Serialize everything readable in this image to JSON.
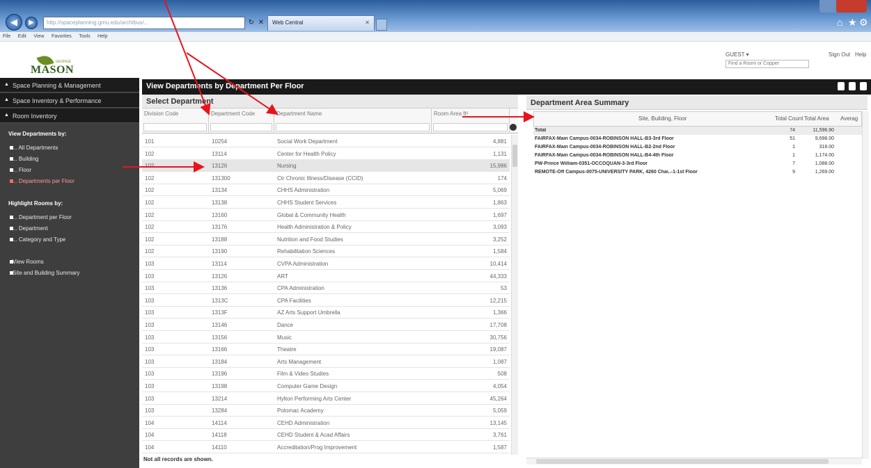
{
  "browser": {
    "address": "http://spaceplanning.gmu.edu/archibus/...",
    "tab_title": "Web Central",
    "menu": [
      "File",
      "Edit",
      "View",
      "Favorites",
      "Tools",
      "Help"
    ]
  },
  "header": {
    "logo_text": "MASON",
    "logo_small": "GEORGE",
    "user": "GUEST ▾",
    "sign_out": "Sign Out",
    "help": "Help",
    "find_placeholder": "Find a Room or Copper"
  },
  "sidebar": {
    "menus": [
      "Space Planning & Management",
      "Space Inventory & Performance",
      "Room Inventory"
    ],
    "view_heading": "View Departments by:",
    "view_links": [
      "... All Departments",
      "... Building",
      "... Floor",
      "... Departments per Floor"
    ],
    "highlight_heading": "Highlight Rooms by:",
    "highlight_links": [
      "... Department per Floor",
      "... Department",
      "... Category and Type"
    ],
    "other_links": [
      "View Rooms",
      "Site and Building Summary"
    ]
  },
  "main": {
    "title": "View Departments by Department Per Floor",
    "select_title": "Select Department",
    "columns": [
      "Division Code",
      "Department Code",
      "Department Name",
      "Room Area ft²"
    ],
    "rows": [
      [
        "101",
        "10254",
        "Social Work Department",
        "4,881"
      ],
      [
        "102",
        "13114",
        "Center for Health Policy",
        "1,131"
      ],
      [
        "102",
        "13126",
        "Nursing",
        "15,986"
      ],
      [
        "102",
        "131300",
        "Ctr Chronic Illness/Disease (CCID)",
        "174"
      ],
      [
        "102",
        "13134",
        "CHHS Administration",
        "5,069"
      ],
      [
        "102",
        "13138",
        "CHHS Student Services",
        "1,863"
      ],
      [
        "102",
        "13160",
        "Global & Community Health",
        "1,697"
      ],
      [
        "102",
        "13176",
        "Health Administration & Policy",
        "3,093"
      ],
      [
        "102",
        "13188",
        "Nutrition and Food Studies",
        "3,252"
      ],
      [
        "102",
        "13190",
        "Rehabilitation Sciences",
        "1,584"
      ],
      [
        "103",
        "13114",
        "CVPA Administration",
        "10,414"
      ],
      [
        "103",
        "13126",
        "ART",
        "44,333"
      ],
      [
        "103",
        "13136",
        "CPA Administration",
        "53"
      ],
      [
        "103",
        "1313C",
        "CPA Facilities",
        "12,215"
      ],
      [
        "103",
        "1313F",
        "AZ Arts Support Umbrella",
        "1,366"
      ],
      [
        "103",
        "13146",
        "Dance",
        "17,708"
      ],
      [
        "103",
        "13156",
        "Music",
        "30,756"
      ],
      [
        "103",
        "13166",
        "Theatre",
        "19,087"
      ],
      [
        "103",
        "13184",
        "Arts Management",
        "1,087"
      ],
      [
        "103",
        "13196",
        "Film & Video Studies",
        "508"
      ],
      [
        "103",
        "13198",
        "Computer Game Design",
        "4,054"
      ],
      [
        "103",
        "13214",
        "Hylton Performing Arts Center",
        "45,264"
      ],
      [
        "103",
        "13284",
        "Potomac Academy",
        "5,059"
      ],
      [
        "104",
        "14114",
        "CEHD Administration",
        "13,145"
      ],
      [
        "104",
        "14118",
        "CEHD Student & Acad Affairs",
        "3,761"
      ],
      [
        "104",
        "14110",
        "Accreditation/Prog Improvement",
        "1,587"
      ]
    ],
    "not_all": "Not all records are shown."
  },
  "summary": {
    "title": "Department Area Summary",
    "columns": [
      "Site, Building, Floor",
      "Total Count",
      "Total Area",
      "Averag"
    ],
    "rows": [
      {
        "site": "Total",
        "count": "74",
        "area": "11,596.90"
      },
      {
        "site": "FAIRFAX-Main Campus-0034-ROBINSON HALL-B3-3rd Floor",
        "count": "51",
        "area": "9,698.00"
      },
      {
        "site": "FAIRFAX-Main Campus-0034-ROBINSON HALL-B2-2nd Floor",
        "count": "1",
        "area": "318.00"
      },
      {
        "site": "FAIRFAX-Main Campus-0034-ROBINSON HALL-B4-4th Floor",
        "count": "1",
        "area": "1,174.00"
      },
      {
        "site": "PW-Prince William-0351-OCCOQUAN-3-3rd Floor",
        "count": "7",
        "area": "1,088.00"
      },
      {
        "site": "REMOTE-Off Campus-0075-UNIVERSITY PARK, 4260 Chai..-1-1st Floor",
        "count": "9",
        "area": "1,269.00"
      }
    ]
  },
  "colors": {
    "arrow": "#e8141c",
    "sidebar": "#3e3e3e",
    "title_bar": "#1a1a1a"
  }
}
